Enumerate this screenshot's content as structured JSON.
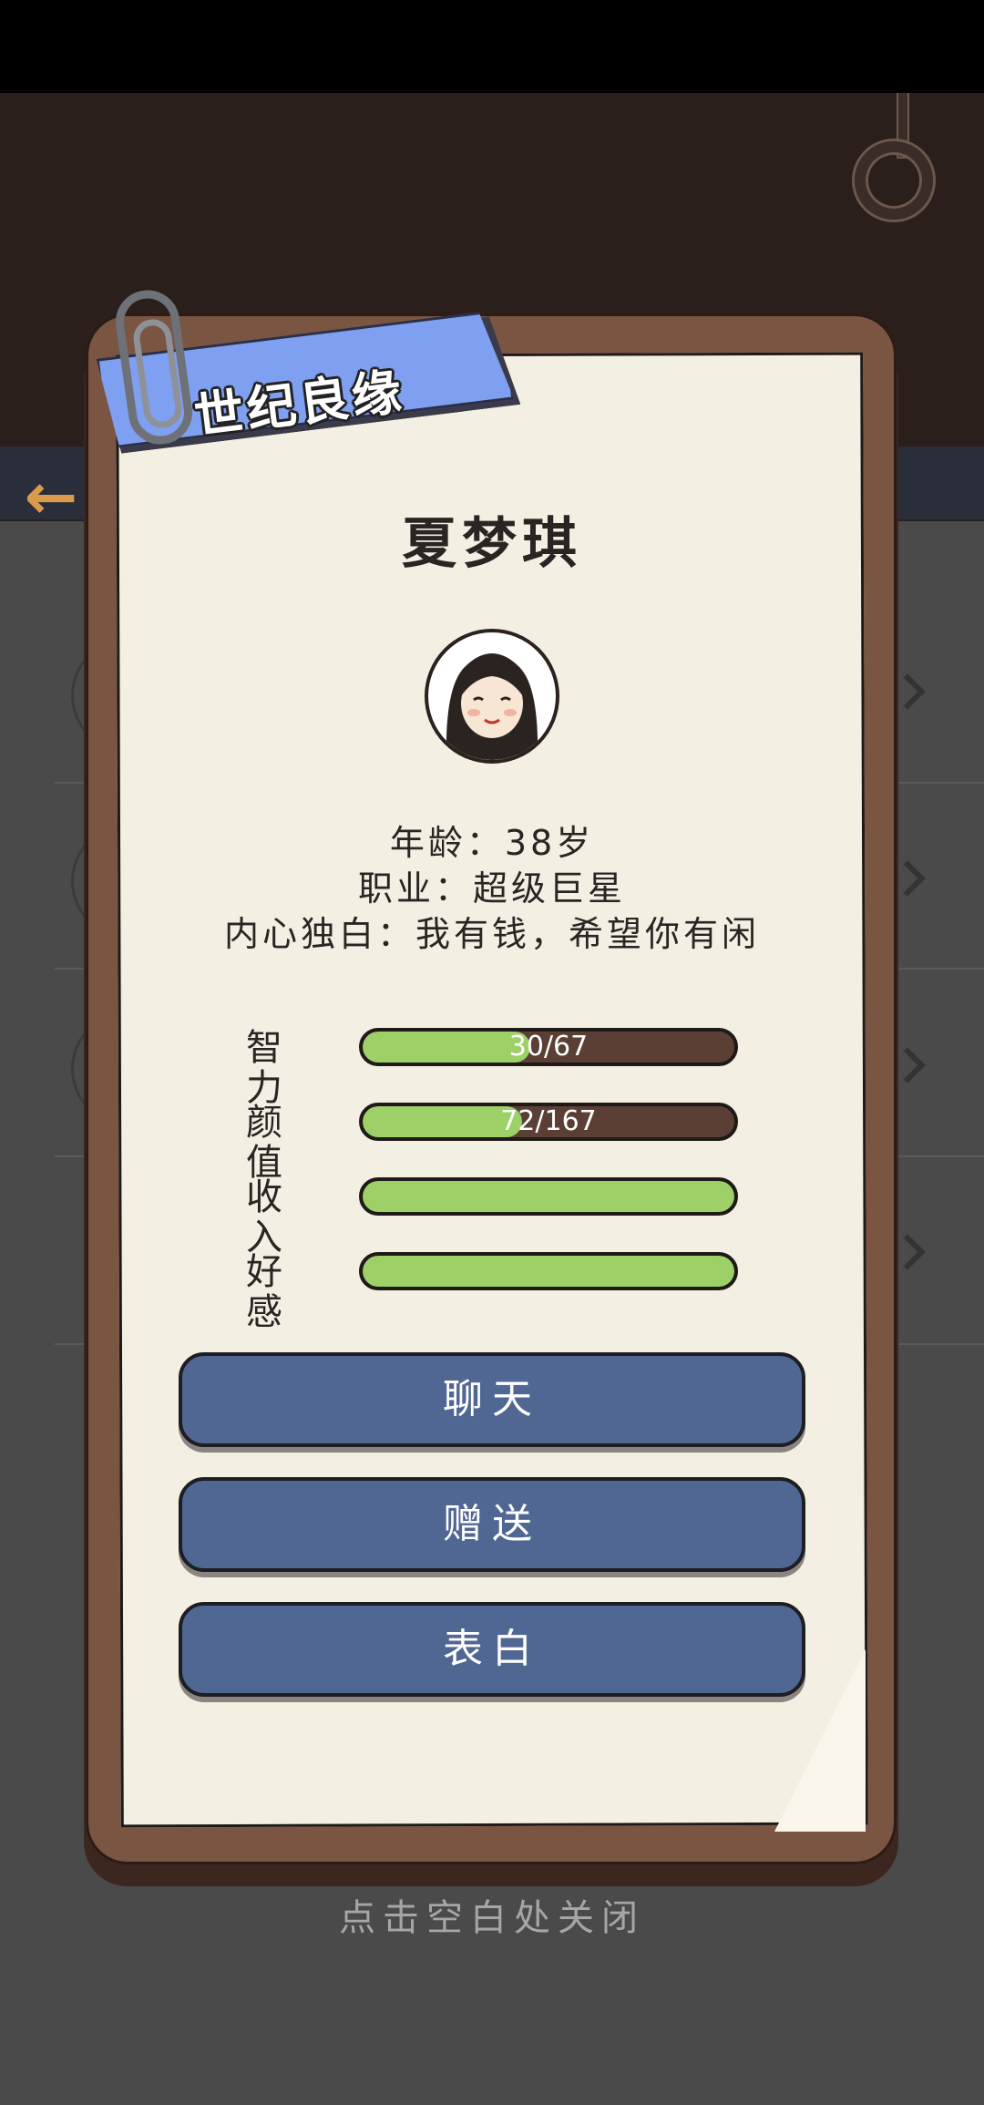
{
  "panel": {
    "title": "世纪良缘"
  },
  "character": {
    "name": "夏梦琪",
    "age_line": "年龄：38岁",
    "job_line": "职业：超级巨星",
    "monologue_line": "内心独白：我有钱，希望你有闲"
  },
  "stats": [
    {
      "label": "智力",
      "text": "30/67",
      "fraction": 0.45
    },
    {
      "label": "颜值",
      "text": "72/167",
      "fraction": 0.43
    },
    {
      "label": "收入",
      "text": "",
      "fraction": 1.0
    },
    {
      "label": "好感",
      "text": "",
      "fraction": 1.0
    }
  ],
  "actions": {
    "chat": "聊天",
    "gift": "赠送",
    "confess": "表白"
  },
  "footer": {
    "close_hint": "点击空白处关闭"
  },
  "colors": {
    "accent_ribbon": "#7f9ff0",
    "button": "#506793",
    "stat_fill": "#9dd167",
    "board": "#7a5542",
    "paper": "#f4efe3"
  },
  "icons": {
    "back": "back-arrow-icon",
    "clip": "paperclip-icon"
  }
}
